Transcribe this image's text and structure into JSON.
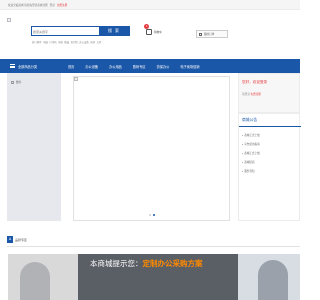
{
  "topbar": {
    "links": [
      "欢迎光临商城！请您登录或免费注册",
      "登录",
      "免费注册"
    ],
    "welcome": "欢迎光临商城 请您先登录商城注册",
    "login": "登录",
    "register": "免费注册"
  },
  "search": {
    "placeholder": "搜索关键字",
    "button": "搜 索",
    "hotwords": [
      "热门搜索",
      "电脑",
      "打印机",
      "电源",
      "硒鼓",
      "复印纸",
      "办公设备",
      "耗材",
      "文具"
    ]
  },
  "cart": {
    "label": "购物车",
    "count": "0"
  },
  "order": {
    "label": "我的订单"
  },
  "nav": {
    "category_label": "全部商品分类",
    "items": [
      "首页",
      "办公设备",
      "办公用品",
      "数码专区",
      "劳保办公",
      "电子卖场促销"
    ]
  },
  "category_panel": {
    "first_row": "数码"
  },
  "banner": {
    "slides": 2,
    "active": 2
  },
  "login_box": {
    "greeting": "您好，欢迎登录",
    "sub_text": "请登录",
    "register": "免费注册"
  },
  "notice": {
    "title": "商城公告",
    "items": [
      "商城正式上线",
      "平台使用指南",
      "商城正式上线",
      "商城招商",
      "服务须知"
    ]
  },
  "brand_section": {
    "label": "品牌专区",
    "icon_glyph": "A"
  },
  "promo": {
    "prefix": "本商城提示您：",
    "highlight": "定制办公采购方案",
    "highlight_color": "#ff8a00"
  },
  "colors": {
    "primary": "#1a57a8",
    "accent": "#e4393c"
  }
}
